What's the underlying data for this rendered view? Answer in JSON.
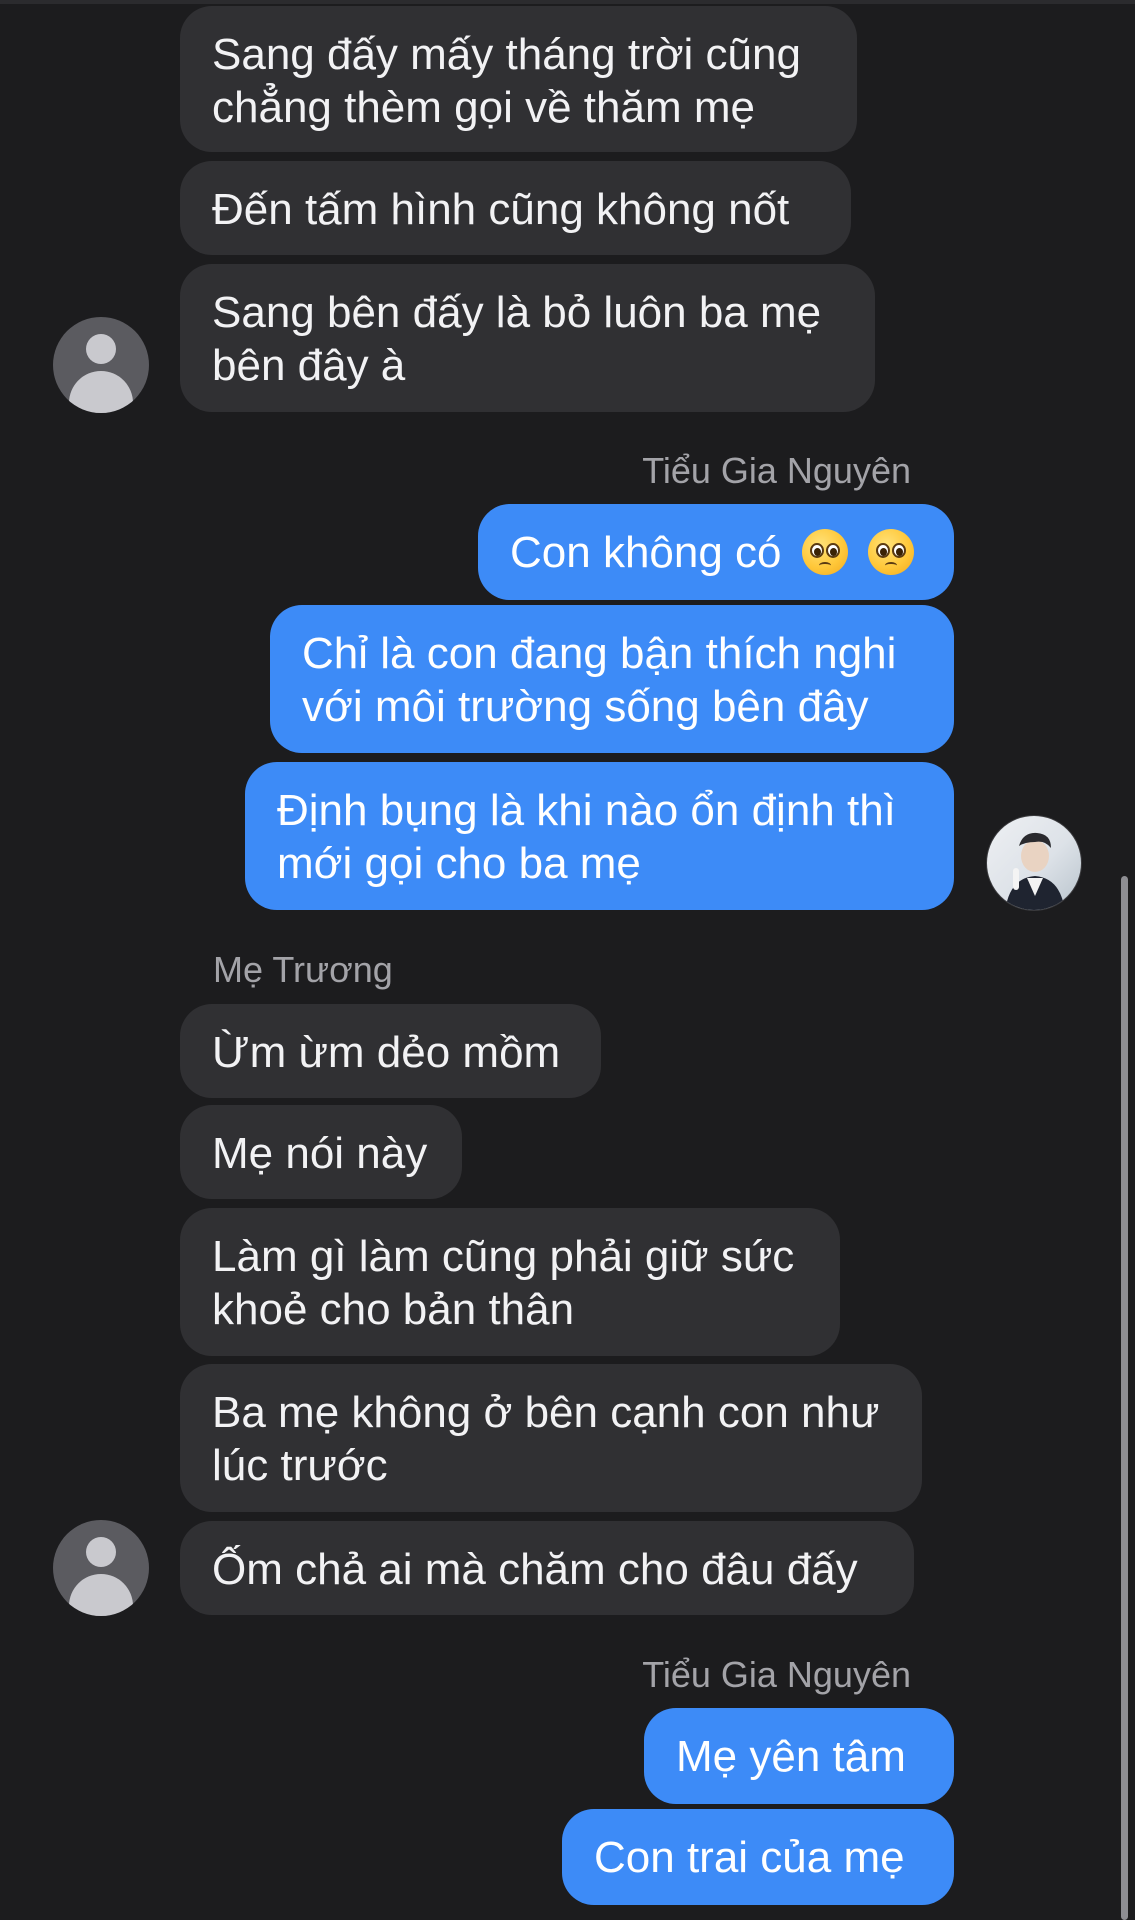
{
  "thread": {
    "incoming_block_1": [
      {
        "line1": "Sang đấy mấy tháng trời cũng",
        "line2": "chẳng thèm gọi về thăm mẹ"
      },
      {
        "line1": "Đến tấm hình cũng không nốt"
      },
      {
        "line1": "Sang bên đấy là bỏ luôn ba mẹ",
        "line2": "bên đây à"
      }
    ],
    "outgoing_sender_1": "Tiểu Gia Nguyên",
    "outgoing_block_1": [
      {
        "line1": "Con không có",
        "emojis": [
          "pleading-face-emoji",
          "pleading-face-emoji"
        ]
      },
      {
        "line1": "Chỉ là con đang bận thích nghi",
        "line2": "với môi trường sống bên đây"
      },
      {
        "line1": "Định bụng là khi nào ổn định thì",
        "line2": "mới gọi cho ba mẹ"
      }
    ],
    "incoming_sender_2": "Mẹ Trương",
    "incoming_block_2": [
      {
        "line1": "Ừm ừm dẻo mồm"
      },
      {
        "line1": "Mẹ nói này"
      },
      {
        "line1": "Làm gì làm cũng phải giữ sức",
        "line2": "khoẻ cho bản thân"
      },
      {
        "line1": "Ba mẹ không ở bên cạnh con như",
        "line2": "lúc trước"
      },
      {
        "line1": "Ốm chả ai mà chăm cho đâu đấy"
      }
    ],
    "outgoing_sender_2": "Tiểu Gia Nguyên",
    "outgoing_block_2": [
      {
        "line1": "Mẹ yên tâm"
      },
      {
        "line1": "Con trai của mẹ"
      }
    ]
  },
  "colors": {
    "background": "#1c1c1e",
    "incoming_bubble": "#303033",
    "outgoing_bubble": "#3d8bf7",
    "sender_name": "#a3a3a8"
  }
}
